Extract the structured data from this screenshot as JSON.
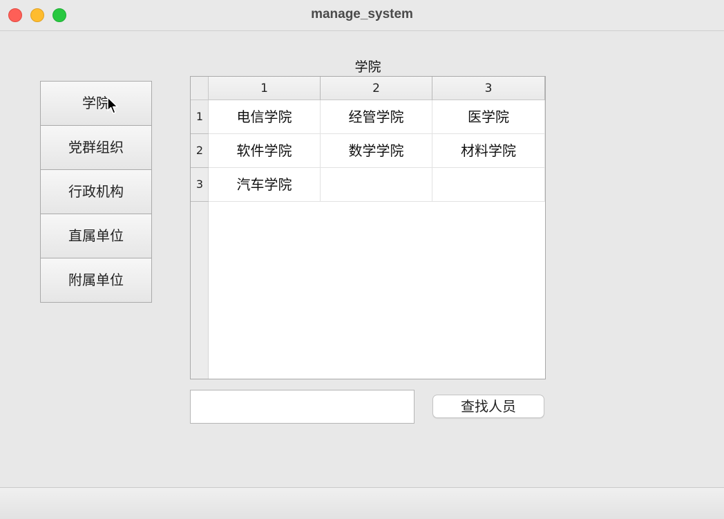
{
  "window": {
    "title": "manage_system"
  },
  "sidebar": {
    "items": [
      {
        "label": "学院"
      },
      {
        "label": "党群组织"
      },
      {
        "label": "行政机构"
      },
      {
        "label": "直属单位"
      },
      {
        "label": "附属单位"
      }
    ]
  },
  "table": {
    "caption": "学院",
    "column_headers": [
      "1",
      "2",
      "3"
    ],
    "row_headers": [
      "1",
      "2",
      "3"
    ],
    "rows": [
      [
        "电信学院",
        "经管学院",
        "医学院"
      ],
      [
        "软件学院",
        "数学学院",
        "材料学院"
      ],
      [
        "汽车学院",
        "",
        ""
      ]
    ]
  },
  "search": {
    "value": "",
    "placeholder": ""
  },
  "find_button": {
    "label": "查找人员"
  },
  "colors": {
    "close": "#fe5f57",
    "minimize": "#febc2e",
    "maximize": "#28c840",
    "window_bg": "#e8e8e8"
  }
}
